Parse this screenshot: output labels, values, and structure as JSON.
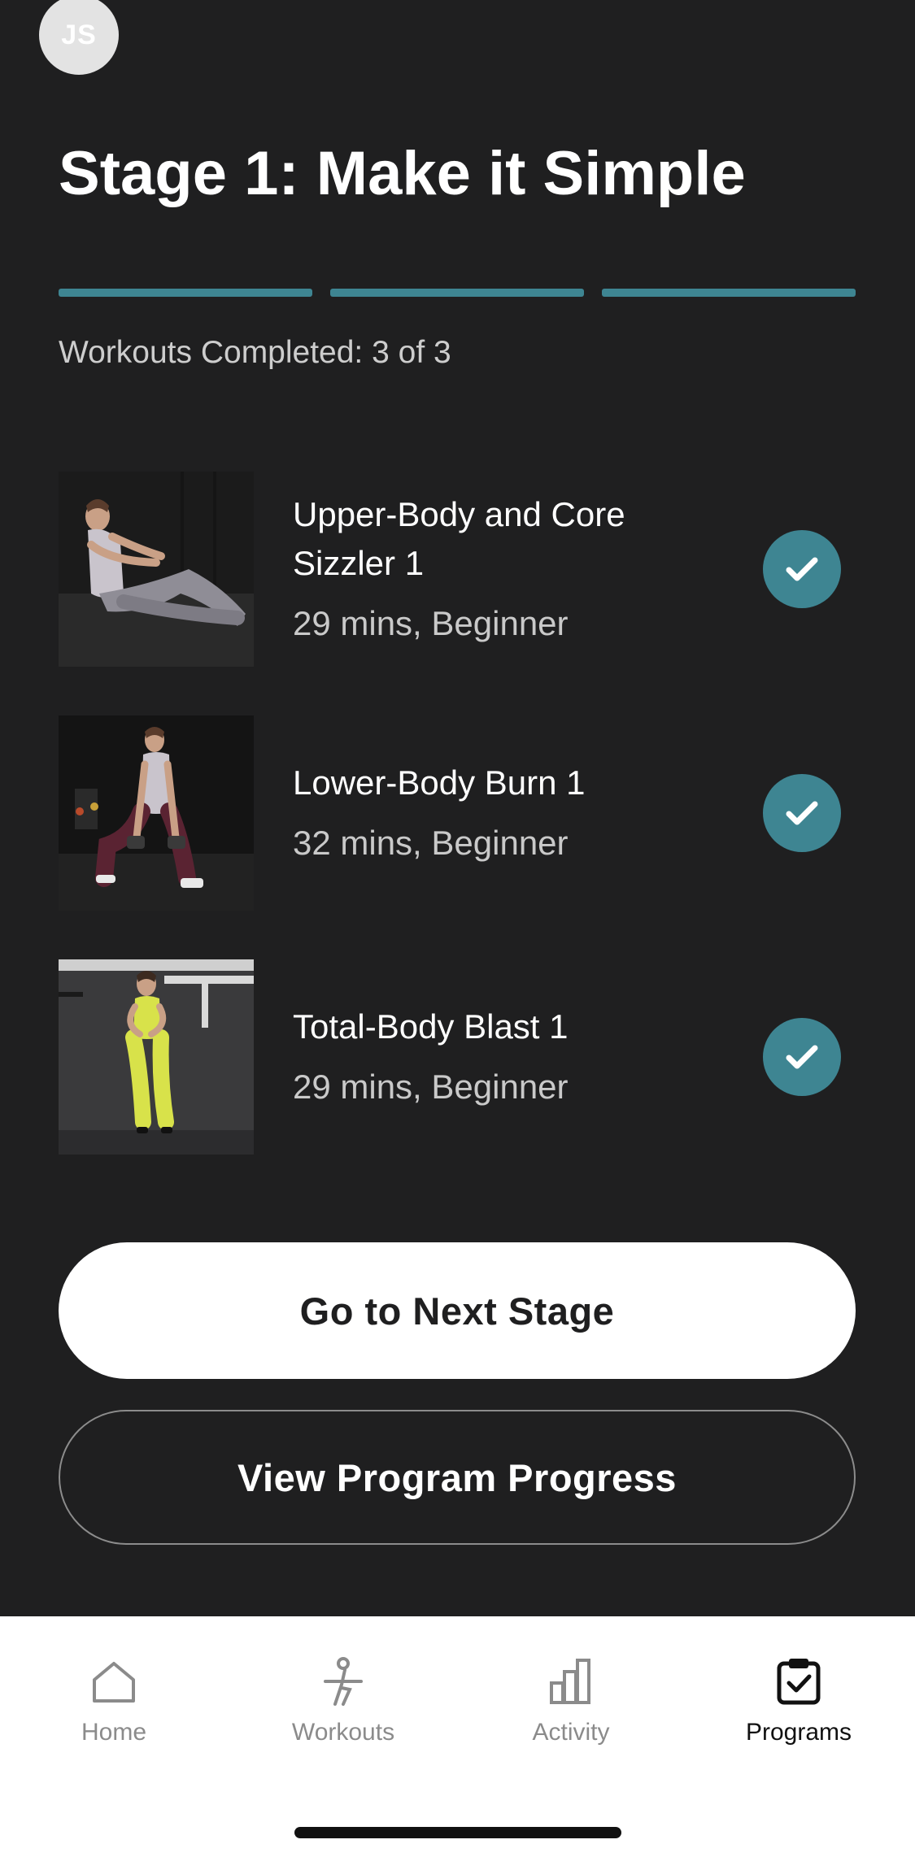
{
  "user": {
    "initials": "JS"
  },
  "stage": {
    "title": "Stage 1: Make it Simple",
    "progress_segments_completed": 3,
    "progress_segments_total": 3,
    "completed_text": "Workouts Completed: 3 of 3"
  },
  "workouts": [
    {
      "name": "Upper-Body and Core Sizzler 1",
      "meta": "29 mins, Beginner",
      "completed": true
    },
    {
      "name": "Lower-Body Burn 1",
      "meta": "32 mins, Beginner",
      "completed": true
    },
    {
      "name": "Total-Body Blast 1",
      "meta": "29 mins, Beginner",
      "completed": true
    }
  ],
  "actions": {
    "next_stage_label": "Go to Next Stage",
    "view_progress_label": "View Program Progress"
  },
  "tabbar": {
    "items": [
      {
        "label": "Home",
        "icon": "home-icon"
      },
      {
        "label": "Workouts",
        "icon": "workout-figure-icon"
      },
      {
        "label": "Activity",
        "icon": "bar-chart-icon"
      },
      {
        "label": "Programs",
        "icon": "clipboard-check-icon"
      }
    ],
    "active": "Programs"
  },
  "colors": {
    "background": "#1f1f20",
    "accent": "#3e8592",
    "tabbar_bg": "#ffffff"
  }
}
